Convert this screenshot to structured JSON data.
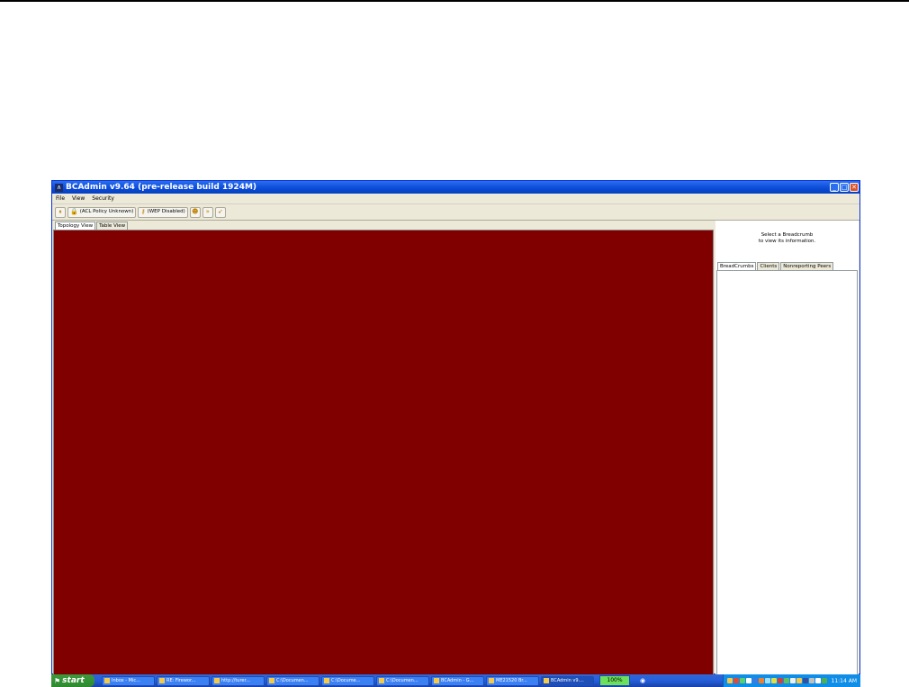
{
  "window": {
    "title": "BCAdmin v9.64 (pre-release build 1924M)"
  },
  "menu": [
    "File",
    "View",
    "Security"
  ],
  "toolbar": {
    "acl_label": "(ACL Policy Unknown)",
    "wep_label": "(WEP Disabled)"
  },
  "left_tabs": [
    "Topology View",
    "Table View"
  ],
  "canvas_color": "#800000",
  "info_panel": {
    "line1": "Select a Breadcrumb",
    "line2": "to view its information."
  },
  "right_tabs": [
    "BreadCrumbs",
    "Clients",
    "Nonreporting Peers"
  ],
  "taskbar": {
    "start_label": "start",
    "tasks": [
      "Inbox - Mic...",
      "RE: Firewor...",
      "http://turer...",
      "C:\\Documen...",
      "C:\\Docume...",
      "C:\\Documen...",
      "BCAdmin - G...",
      "ME21520 Br...",
      "BCAdmin v9...."
    ],
    "zoom": "100%",
    "clock": "11:14 AM"
  }
}
